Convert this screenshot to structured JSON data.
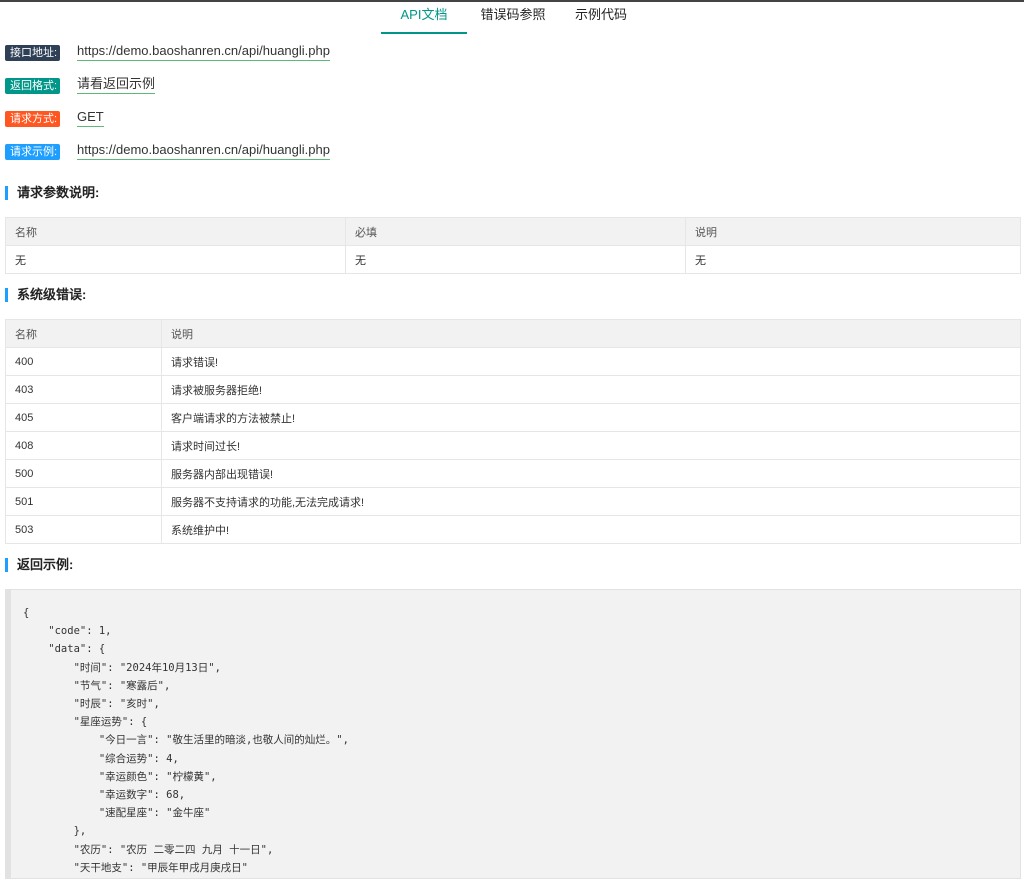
{
  "tabs": [
    {
      "label": "API文档",
      "active": true
    },
    {
      "label": "错误码参照",
      "active": false
    },
    {
      "label": "示例代码",
      "active": false
    }
  ],
  "info": [
    {
      "label": "接口地址:",
      "value": "https://demo.baoshanren.cn/api/huangli.php",
      "color": "#2F4056"
    },
    {
      "label": "返回格式:",
      "value": "请看返回示例",
      "color": "#009688"
    },
    {
      "label": "请求方式:",
      "value": "GET",
      "color": "#FF5722"
    },
    {
      "label": "请求示例:",
      "value": "https://demo.baoshanren.cn/api/huangli.php",
      "color": "#1E9FFF"
    }
  ],
  "params_section": {
    "title": "请求参数说明:",
    "headers": [
      "名称",
      "必填",
      "说明"
    ],
    "rows": [
      [
        "无",
        "无",
        "无"
      ]
    ]
  },
  "errors_section": {
    "title": "系统级错误:",
    "headers": [
      "名称",
      "说明"
    ],
    "rows": [
      [
        "400",
        "请求错误!"
      ],
      [
        "403",
        "请求被服务器拒绝!"
      ],
      [
        "405",
        "客户端请求的方法被禁止!"
      ],
      [
        "408",
        "请求时间过长!"
      ],
      [
        "500",
        "服务器内部出现错误!"
      ],
      [
        "501",
        "服务器不支持请求的功能,无法完成请求!"
      ],
      [
        "503",
        "系统维护中!"
      ]
    ]
  },
  "example_section": {
    "title": "返回示例:",
    "code": "{\n    \"code\": 1,\n    \"data\": {\n        \"时间\": \"2024年10月13日\",\n        \"节气\": \"寒露后\",\n        \"时辰\": \"亥时\",\n        \"星座运势\": {\n            \"今日一言\": \"敬生活里的暗淡,也敬人间的灿烂。\",\n            \"综合运势\": 4,\n            \"幸运颜色\": \"柠檬黄\",\n            \"幸运数字\": 68,\n            \"速配星座\": \"金牛座\"\n        },\n        \"农历\": \"农历 二零二四 九月 十一日\",\n        \"天干地支\": \"甲辰年甲戌月庚戌日\""
  }
}
